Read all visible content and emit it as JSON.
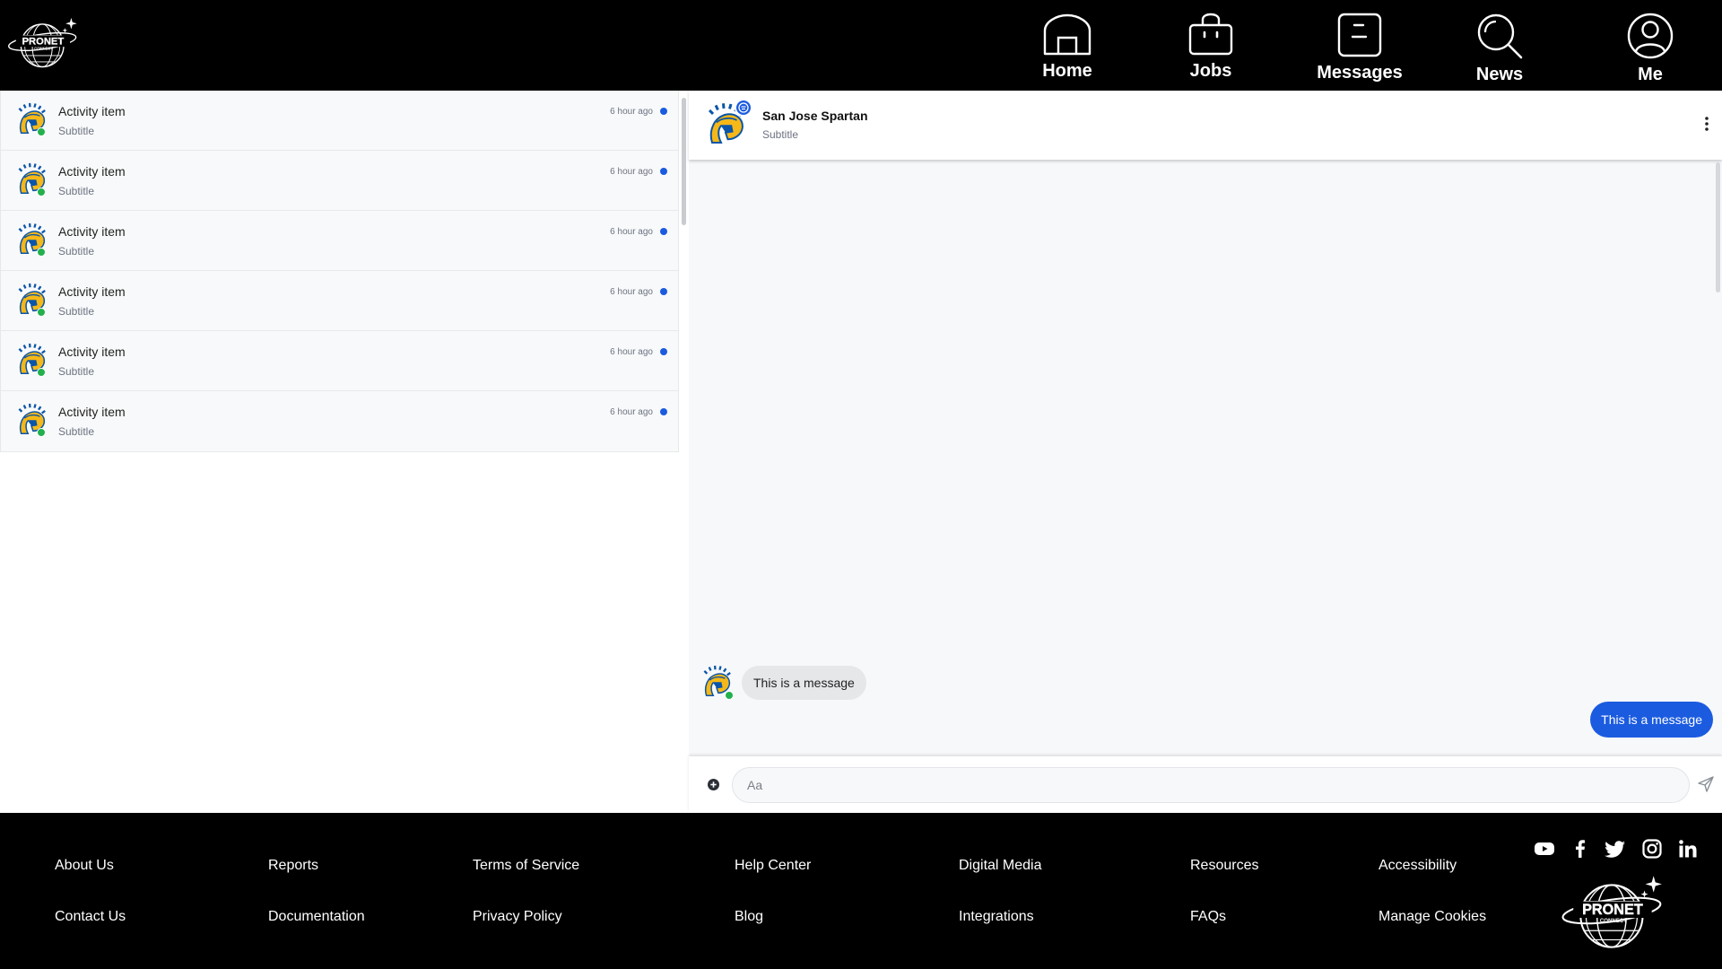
{
  "brand": {
    "logo_text": "PRONET",
    "logo_subtext": "CONNECT"
  },
  "nav": [
    {
      "label": "Home",
      "icon": "home-icon"
    },
    {
      "label": "Jobs",
      "icon": "briefcase-icon"
    },
    {
      "label": "Messages",
      "icon": "message-icon"
    },
    {
      "label": "News",
      "icon": "search-icon"
    },
    {
      "label": "Me",
      "icon": "user-icon"
    }
  ],
  "activity_list": [
    {
      "title": "Activity item",
      "subtitle": "Subtitle",
      "time": "6 hour ago",
      "unread": true,
      "online": true
    },
    {
      "title": "Activity item",
      "subtitle": "Subtitle",
      "time": "6 hour ago",
      "unread": true,
      "online": true
    },
    {
      "title": "Activity item",
      "subtitle": "Subtitle",
      "time": "6 hour ago",
      "unread": true,
      "online": true
    },
    {
      "title": "Activity item",
      "subtitle": "Subtitle",
      "time": "6 hour ago",
      "unread": true,
      "online": true
    },
    {
      "title": "Activity item",
      "subtitle": "Subtitle",
      "time": "6 hour ago",
      "unread": true,
      "online": true
    },
    {
      "title": "Activity item",
      "subtitle": "Subtitle",
      "time": "6 hour ago",
      "unread": true,
      "online": true
    }
  ],
  "chat": {
    "name": "San Jose Spartan",
    "subtitle": "Subtitle",
    "messages": [
      {
        "direction": "incoming",
        "text": "This is a message"
      },
      {
        "direction": "outgoing",
        "text": "This is a message"
      }
    ],
    "composer": {
      "placeholder": "Aa",
      "value": ""
    }
  },
  "footer": {
    "links": [
      [
        "About Us",
        "Contact Us"
      ],
      [
        "Reports",
        "Documentation"
      ],
      [
        "Terms of Service",
        "Privacy Policy"
      ],
      [
        "Help Center",
        "Blog"
      ],
      [
        "Digital Media",
        "Integrations"
      ],
      [
        "Resources",
        "FAQs"
      ],
      [
        "Accessibility",
        "Manage Cookies"
      ]
    ],
    "social": [
      "youtube-icon",
      "facebook-icon",
      "twitter-icon",
      "instagram-icon",
      "linkedin-icon"
    ]
  },
  "colors": {
    "accent": "#1b5be0",
    "online": "#22b14c",
    "nav_bg": "#000000",
    "spartan_gold": "#f5b818",
    "spartan_blue": "#0a55a8"
  }
}
